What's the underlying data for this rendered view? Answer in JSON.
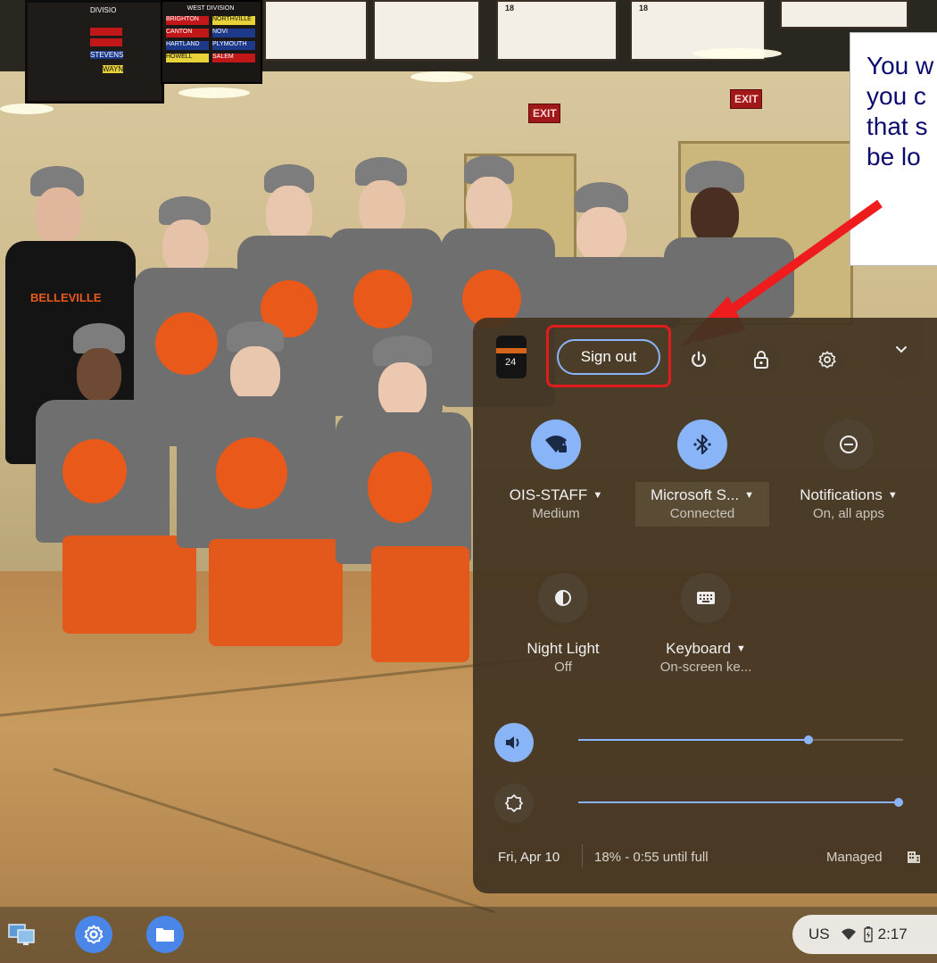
{
  "annotation": {
    "text": "You w\nyou c\nthat s\nbe lo",
    "highlight_color": "#e01c1c",
    "arrow_color": "#ee1c1c"
  },
  "quick_settings": {
    "avatar_icon": "jersey-avatar",
    "sign_out_label": "Sign out",
    "header_icons": [
      "power-icon",
      "lock-icon",
      "settings-gear-icon",
      "chevron-down-icon"
    ],
    "tiles": [
      {
        "label": "OIS-STAFF",
        "sub": "Medium",
        "icon": "wifi-locked-icon",
        "state": "on",
        "has_menu": true
      },
      {
        "label": "Microsoft S...",
        "sub": "Connected",
        "icon": "bluetooth-icon",
        "state": "on",
        "has_menu": true
      },
      {
        "label": "Notifications",
        "sub": "On, all apps",
        "icon": "do-not-disturb-icon",
        "state": "off",
        "has_menu": true
      },
      {
        "label": "Night Light",
        "sub": "Off",
        "icon": "night-light-icon",
        "state": "off",
        "has_menu": false
      },
      {
        "label": "Keyboard",
        "sub": "On-screen ke...",
        "icon": "keyboard-icon",
        "state": "off",
        "has_menu": true
      }
    ],
    "volume_level": 0.71,
    "brightness_level": 1.0,
    "accent_color": "#8ab4f8",
    "footer": {
      "date": "Fri, Apr 10",
      "battery": "18% - 0:55 until full",
      "managed": "Managed"
    }
  },
  "shelf": {
    "apps": [
      "remote-desktop-icon",
      "settings-app-icon",
      "files-app-icon"
    ],
    "status": {
      "ime": "US",
      "time": "2:17"
    }
  },
  "wallpaper": {
    "exit_signs": [
      "EXIT",
      "EXIT"
    ],
    "jersey_text": "BELLEVILLE",
    "division_board_title": "WEST DIVISION",
    "division_board_rows": [
      [
        "BRIGHTON",
        "NORTHVILLE"
      ],
      [
        "CANTON",
        "NOVI"
      ],
      [
        "HARTLAND",
        "PLYMOUTH"
      ],
      [
        "HOWELL",
        "SALEM"
      ]
    ],
    "scoreboard_rows": [
      "DIVISIO",
      "STEVENS",
      "WAYN"
    ],
    "banner_numbers": [
      "18",
      "18"
    ]
  }
}
